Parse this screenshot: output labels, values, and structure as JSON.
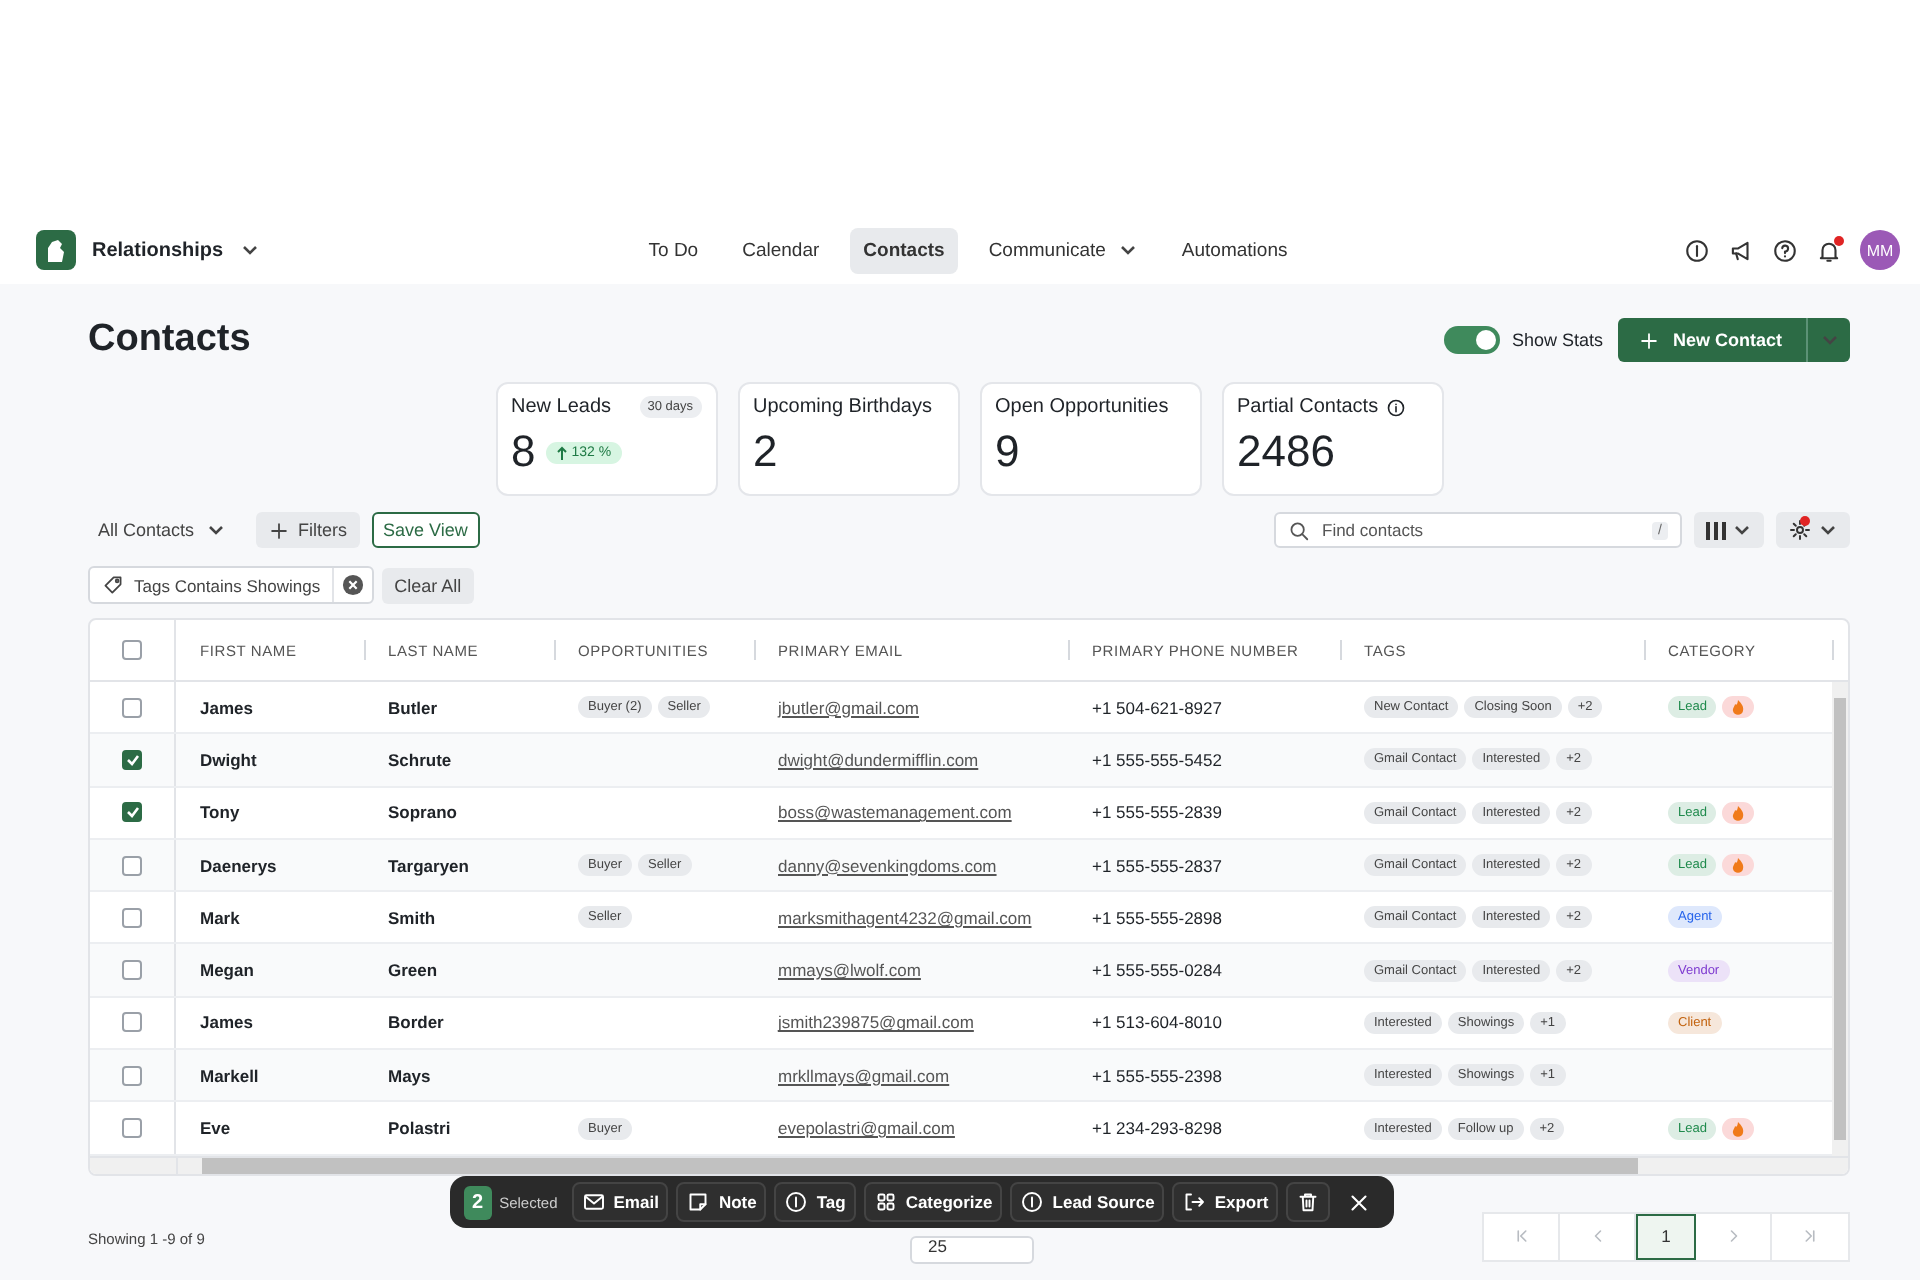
{
  "app": {
    "name": "Relationships"
  },
  "nav": [
    {
      "label": "To Do",
      "selected": false,
      "menu": false
    },
    {
      "label": "Calendar",
      "selected": false,
      "menu": false
    },
    {
      "label": "Contacts",
      "selected": true,
      "menu": false
    },
    {
      "label": "Communicate",
      "selected": false,
      "menu": true
    },
    {
      "label": "Automations",
      "selected": false,
      "menu": false
    }
  ],
  "user": {
    "initials": "MM",
    "notification": true
  },
  "page": {
    "title": "Contacts",
    "show_stats": {
      "label": "Show Stats",
      "on": true
    },
    "new_button": "New Contact"
  },
  "stats": [
    {
      "title": "New Leads",
      "value": "8",
      "period": "30 days",
      "change": "132 %",
      "info": false
    },
    {
      "title": "Upcoming Birthdays",
      "value": "2",
      "info": false
    },
    {
      "title": "Open Opportunities",
      "value": "9",
      "info": false
    },
    {
      "title": "Partial Contacts",
      "value": "2486",
      "info": true
    }
  ],
  "toolbar": {
    "view": "All Contacts",
    "filters_button": "Filters",
    "save_button": "Save View",
    "search": {
      "placeholder": "Find contacts",
      "shortcut": "/"
    },
    "settings_alert": true
  },
  "filter_chips": [
    {
      "label": "Tags Contains Showings"
    }
  ],
  "clear_button": "Clear All",
  "table": {
    "all_checked": false,
    "columns": [
      "FIRST NAME",
      "LAST NAME",
      "OPPORTUNITIES",
      "PRIMARY EMAIL",
      "PRIMARY PHONE NUMBER",
      "TAGS",
      "CATEGORY"
    ],
    "rows": [
      {
        "first": "James",
        "last": "Butler",
        "selected": false,
        "opportunities": [
          "Buyer (2)",
          "Seller"
        ],
        "email": "jbutler@gmail.com",
        "phone": "+1 504-621-8927",
        "tags": [
          "New Contact",
          "Closing Soon",
          "+2"
        ],
        "category": {
          "label": "Lead",
          "color": "#1f8a4c"
        },
        "hot": true
      },
      {
        "first": "Dwight",
        "last": "Schrute",
        "selected": true,
        "opportunities": [],
        "email": "dwight@dundermifflin.com",
        "phone": "+1 555-555-5452",
        "tags": [
          "Gmail Contact",
          "Interested",
          "+2"
        ],
        "hot": false
      },
      {
        "first": "Tony",
        "last": "Soprano",
        "selected": true,
        "opportunities": [],
        "email": "boss@wastemanagement.com",
        "phone": "+1 555-555-2839",
        "tags": [
          "Gmail Contact",
          "Interested",
          "+2"
        ],
        "category": {
          "label": "Lead",
          "color": "#1f8a4c"
        },
        "hot": true
      },
      {
        "first": "Daenerys",
        "last": "Targaryen",
        "selected": false,
        "opportunities": [
          "Buyer",
          "Seller"
        ],
        "email": "danny@sevenkingdoms.com",
        "phone": "+1 555-555-2837",
        "tags": [
          "Gmail Contact",
          "Interested",
          "+2"
        ],
        "category": {
          "label": "Lead",
          "color": "#1f8a4c"
        },
        "hot": true
      },
      {
        "first": "Mark",
        "last": "Smith",
        "selected": false,
        "opportunities": [
          "Seller"
        ],
        "email": "marksmithagent4232@gmail.com",
        "phone": "+1 555-555-2898",
        "tags": [
          "Gmail Contact",
          "Interested",
          "+2"
        ],
        "category": {
          "label": "Agent",
          "color": "#2563eb"
        },
        "hot": false
      },
      {
        "first": "Megan",
        "last": "Green",
        "selected": false,
        "opportunities": [],
        "email": "mmays@lwolf.com",
        "phone": "+1 555-555-0284",
        "tags": [
          "Gmail Contact",
          "Interested",
          "+2"
        ],
        "category": {
          "label": "Vendor",
          "color": "#7e3bd0"
        },
        "hot": false
      },
      {
        "first": "James",
        "last": "Border",
        "selected": false,
        "opportunities": [],
        "email": "jsmith239875@gmail.com",
        "phone": "+1 513-604-8010",
        "tags": [
          "Interested",
          "Showings",
          "+1"
        ],
        "category": {
          "label": "Client",
          "color": "#c2610c"
        },
        "hot": false
      },
      {
        "first": "Markell",
        "last": "Mays",
        "selected": false,
        "opportunities": [],
        "email": "mrkllmays@gmail.com",
        "phone": "+1 555-555-2398",
        "tags": [
          "Interested",
          "Showings",
          "+1"
        ],
        "hot": false
      },
      {
        "first": "Eve",
        "last": "Polastri",
        "selected": false,
        "opportunities": [
          "Buyer"
        ],
        "email": "evepolastri@gmail.com",
        "phone": "+1 234-293-8298",
        "tags": [
          "Interested",
          "Follow up",
          "+2"
        ],
        "category": {
          "label": "Lead",
          "color": "#1f8a4c"
        },
        "hot": true
      }
    ]
  },
  "footer": {
    "summary": "Showing 1 -9 of 9",
    "page_size": "25",
    "pages": [
      {
        "label": "1",
        "selected": true
      }
    ]
  },
  "selection_bar": {
    "count": "2",
    "label": "Selected",
    "actions": [
      "Email",
      "Note",
      "Tag",
      "Categorize",
      "Lead Source",
      "Export"
    ]
  }
}
